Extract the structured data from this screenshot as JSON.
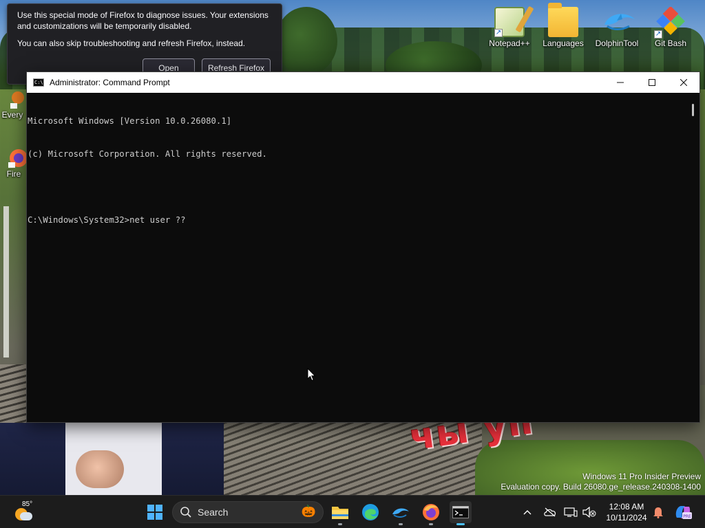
{
  "firefox_notice": {
    "message1": "Use this special mode of Firefox to diagnose issues. Your extensions and customizations will be temporarily disabled.",
    "message2": "You can also skip troubleshooting and refresh Firefox, instead.",
    "open_label": "Open",
    "refresh_label": "Refresh Firefox"
  },
  "desktop_icons": [
    {
      "label": "Notepad++",
      "icon": "notepad-plus-plus-icon"
    },
    {
      "label": "Languages",
      "icon": "folder-icon"
    },
    {
      "label": "DolphinTool",
      "icon": "dolphin-icon"
    },
    {
      "label": "Git Bash",
      "icon": "git-bash-icon"
    }
  ],
  "desktop_left_icons": [
    {
      "label": "Every",
      "icon": "everything-search-icon"
    },
    {
      "label": "Fire",
      "icon": "firefox-icon"
    }
  ],
  "cmd": {
    "title": "Administrator: Command Prompt",
    "lines": [
      "Microsoft Windows [Version 10.0.26080.1]",
      "(c) Microsoft Corporation. All rights reserved.",
      "",
      "C:\\Windows\\System32>net user ??"
    ]
  },
  "wallpaper": {
    "graffiti": "чы уп"
  },
  "watermark": {
    "line1": "Windows 11 Pro Insider Preview",
    "line2": "Evaluation copy. Build 26080.ge_release.240308-1400"
  },
  "taskbar": {
    "weather_temp": "85°",
    "search_label": "Search",
    "apps": [
      "start-icon",
      "file-explorer-icon",
      "edge-icon",
      "dolphin-icon",
      "firefox-icon",
      "terminal-icon"
    ],
    "time": "12:08 AM",
    "date": "10/11/2024"
  },
  "colors": {
    "cmd_background": "#0c0c0c",
    "cmd_text": "#cccccc",
    "taskbar": "#1c1c1c",
    "accent": "#4cc2ff"
  }
}
